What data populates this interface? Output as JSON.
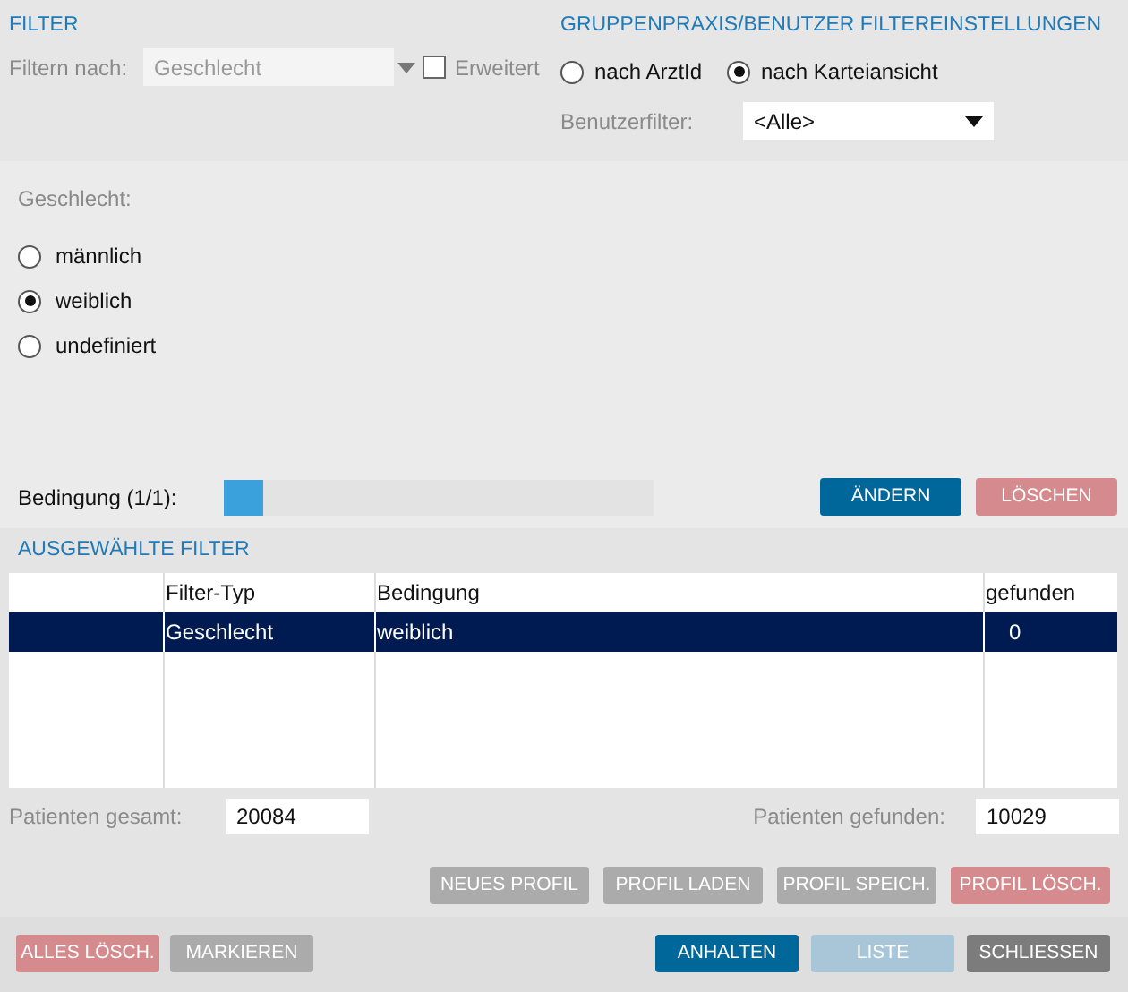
{
  "filter": {
    "heading": "FILTER",
    "filter_by_label": "Filtern nach:",
    "filter_by": {
      "value": "Geschlecht",
      "disabled": true
    },
    "extended": {
      "label": "Erweitert",
      "checked": false,
      "disabled": true
    }
  },
  "group_settings": {
    "heading": "GRUPPENPRAXIS/BENUTZER FILTEREINSTELLUNGEN",
    "options": [
      {
        "label": "nach ArztId",
        "selected": false
      },
      {
        "label": "nach Karteiansicht",
        "selected": true
      }
    ],
    "user_filter_label": "Benutzerfilter:",
    "user_filter": {
      "value": "<Alle>"
    }
  },
  "condition": {
    "label": "Geschlecht:",
    "options": [
      {
        "label": "männlich",
        "selected": false
      },
      {
        "label": "weiblich",
        "selected": true
      },
      {
        "label": "undefiniert",
        "selected": false
      }
    ]
  },
  "progress": {
    "label": "Bedingung (1/1):",
    "level": 0.09
  },
  "condition_buttons": [
    {
      "label": "ÄNDERN",
      "kind": "primary",
      "disabled": false
    },
    {
      "label": "LÖSCHEN",
      "kind": "danger",
      "disabled": true
    }
  ],
  "selected_filters": {
    "heading": "AUSGEWÄHLTE FILTER",
    "columns": [
      "",
      "Filter-Typ",
      "Bedingung",
      "gefunden"
    ],
    "rows": [
      {
        "cells": [
          "",
          "Geschlecht",
          "weiblich",
          "0"
        ],
        "selected": true
      }
    ]
  },
  "totals": [
    {
      "label": "Patienten gesamt:",
      "value": "20084"
    },
    {
      "label": "Patienten gefunden:",
      "value": "10029"
    }
  ],
  "profile_buttons": [
    {
      "label": "NEUES PROFIL",
      "kind": "plain",
      "disabled": true
    },
    {
      "label": "PROFIL LADEN",
      "kind": "plain",
      "disabled": true
    },
    {
      "label": "PROFIL SPEICH.",
      "kind": "plain",
      "disabled": true
    },
    {
      "label": "PROFIL LÖSCH.",
      "kind": "danger",
      "disabled": true
    }
  ],
  "footer_left_buttons": [
    {
      "label": "ALLES LÖSCH.",
      "kind": "danger",
      "disabled": true
    },
    {
      "label": "MARKIEREN",
      "kind": "plain",
      "disabled": true
    }
  ],
  "footer_right_buttons": [
    {
      "label": "ANHALTEN",
      "kind": "primary",
      "disabled": false
    },
    {
      "label": "LISTE",
      "kind": "primary",
      "disabled": true
    },
    {
      "label": "SCHLIESSEN",
      "kind": "dark",
      "disabled": false
    }
  ]
}
